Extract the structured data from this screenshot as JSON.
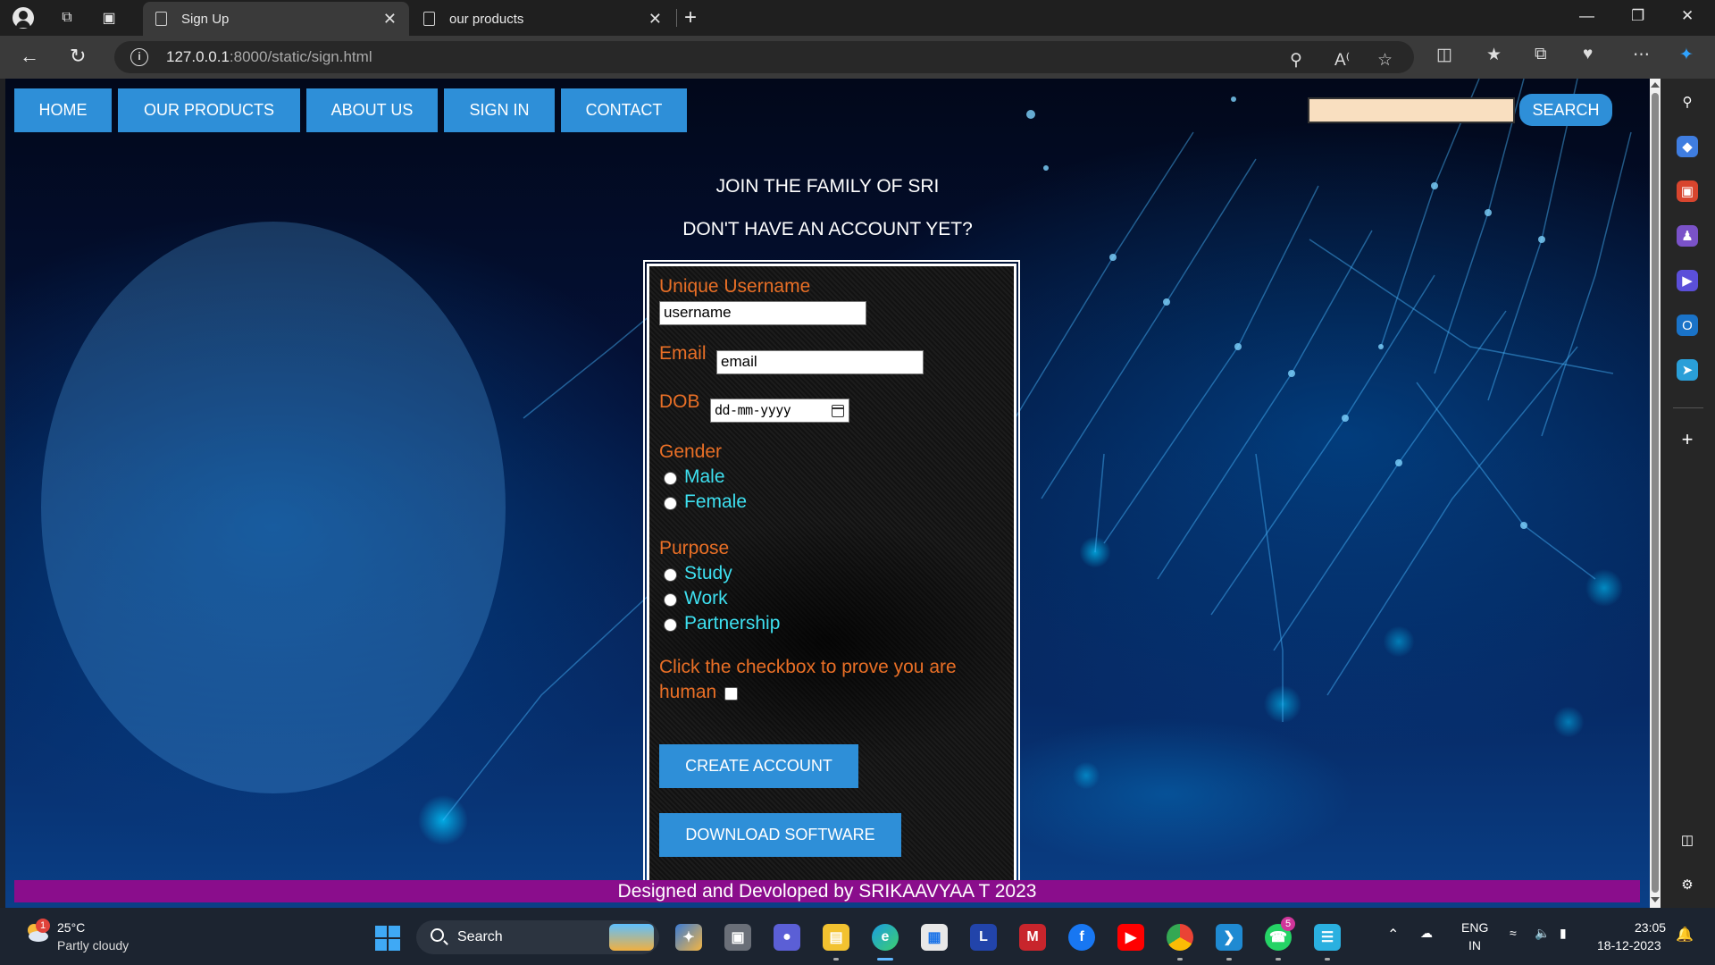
{
  "browser": {
    "tabs": [
      {
        "label": "Sign Up",
        "active": true
      },
      {
        "label": "our products",
        "active": false
      }
    ],
    "url_host": "127.0.0.1",
    "url_rest": ":8000/static/sign.html"
  },
  "nav": {
    "items": [
      "HOME",
      "OUR PRODUCTS",
      "ABOUT US",
      "SIGN IN",
      "CONTACT"
    ],
    "search_label": "SEARCH",
    "search_value": ""
  },
  "headings": {
    "join": "JOIN THE FAMILY OF SRI",
    "no_account": "DON'T HAVE AN ACCOUNT YET?"
  },
  "form": {
    "username_label": "Unique Username",
    "username_value": "username",
    "email_label": "Email",
    "email_value": "email",
    "dob_label": "DOB",
    "dob_value": "dd-mm-yyyy",
    "gender_label": "Gender",
    "gender_options": [
      "Male",
      "Female"
    ],
    "purpose_label": "Purpose",
    "purpose_options": [
      "Study",
      "Work",
      "Partnership"
    ],
    "human_label_line1": "Click the checkbox to prove you are",
    "human_label_line2": "human",
    "create_button": "CREATE ACCOUNT",
    "download_button": "DOWNLOAD SOFTWARE"
  },
  "footer": {
    "text": "Designed and Devoloped by SRIKAAVYAA T 2023"
  },
  "taskbar": {
    "weather_badge": "1",
    "temperature": "25°C",
    "weather_desc": "Partly cloudy",
    "search_label": "Search",
    "whatsapp_badge": "5",
    "lang_line1": "ENG",
    "lang_line2": "IN",
    "time": "23:05",
    "date": "18-12-2023"
  },
  "colors": {
    "nav_button": "#2e8fd8",
    "form_label": "#e96f26",
    "form_option": "#3ee0f0",
    "footer_bar": "#8a0d8c"
  }
}
